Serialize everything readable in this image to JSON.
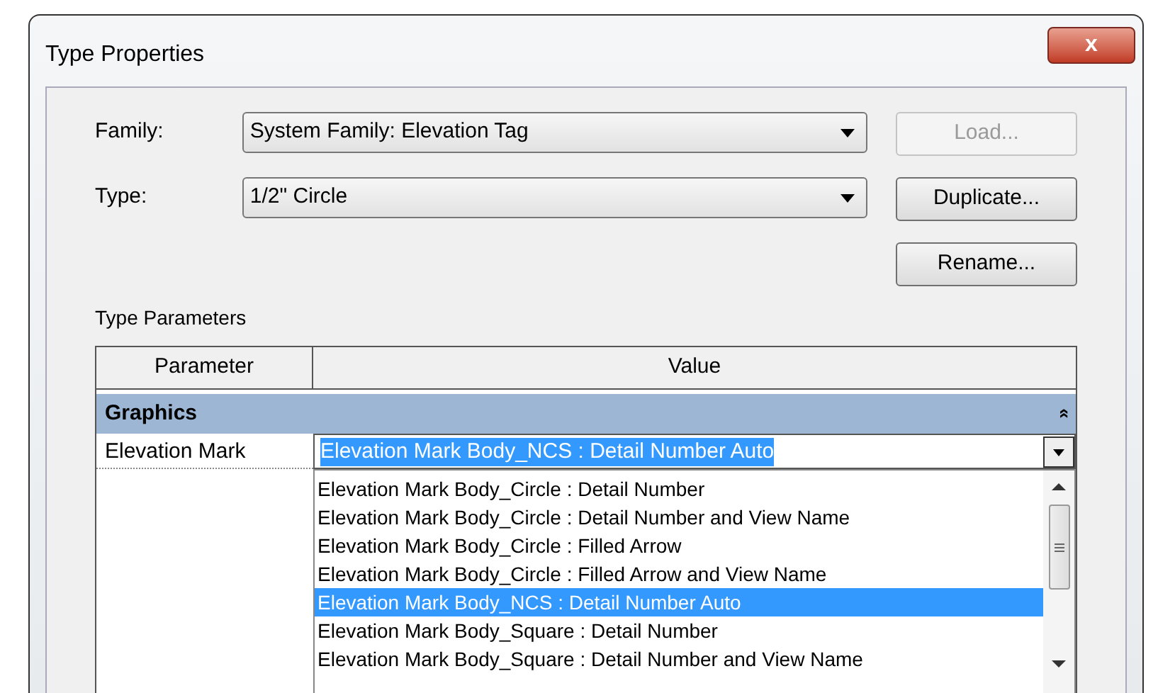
{
  "window": {
    "title": "Type Properties",
    "close": "x"
  },
  "fields": [
    {
      "label": "Family:",
      "value": "System Family: Elevation Tag"
    },
    {
      "label": "Type:",
      "value": "1/2\" Circle"
    }
  ],
  "buttons": [
    {
      "label": "Load...",
      "disabled": true
    },
    {
      "label": "Duplicate...",
      "disabled": false
    },
    {
      "label": "Rename...",
      "disabled": false
    }
  ],
  "section_label": "Type Parameters",
  "table": {
    "columns": [
      "Parameter",
      "Value"
    ],
    "group": {
      "title": "Graphics",
      "collapse": "»"
    },
    "row": {
      "parameter": "Elevation Mark",
      "value": "Elevation Mark Body_NCS : Detail Number Auto"
    }
  },
  "dropdown_list": [
    {
      "label": "Elevation Mark Body_Circle : Detail Number",
      "selected": false
    },
    {
      "label": "Elevation Mark Body_Circle : Detail Number and View Name",
      "selected": false
    },
    {
      "label": "Elevation Mark Body_Circle : Filled Arrow",
      "selected": false
    },
    {
      "label": "Elevation Mark Body_Circle : Filled Arrow and View Name",
      "selected": false
    },
    {
      "label": "Elevation Mark Body_NCS : Detail Number Auto",
      "selected": true
    },
    {
      "label": "Elevation Mark Body_Square : Detail Number",
      "selected": false
    },
    {
      "label": "Elevation Mark Body_Square : Detail Number and View Name",
      "selected": false
    }
  ]
}
